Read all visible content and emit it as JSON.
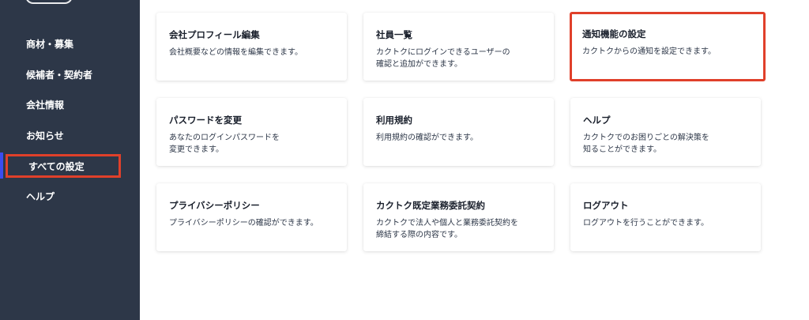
{
  "sidebar": {
    "items": [
      {
        "label": "商材・募集"
      },
      {
        "label": "候補者・契約者"
      },
      {
        "label": "会社情報"
      },
      {
        "label": "お知らせ"
      },
      {
        "label": "すべての設定"
      },
      {
        "label": "ヘルプ"
      }
    ],
    "active_index": 4
  },
  "settings": {
    "cards": [
      {
        "title": "会社プロフィール編集",
        "desc": "会社概要などの情報を編集できます。"
      },
      {
        "title": "社員一覧",
        "desc": "カクトクにログインできるユーザーの\n確認と追加ができます。"
      },
      {
        "title": "通知機能の設定",
        "desc": "カクトクからの通知を設定できます。"
      },
      {
        "title": "パスワードを変更",
        "desc": "あなたのログインパスワードを\n変更できます。"
      },
      {
        "title": "利用規約",
        "desc": "利用規約の確認ができます。"
      },
      {
        "title": "ヘルプ",
        "desc": "カクトクでのお困りごとの解決策を\n知ることができます。"
      },
      {
        "title": "プライバシーポリシー",
        "desc": "プライバシーポリシーの確認ができます。"
      },
      {
        "title": "カクトク既定業務委託契約",
        "desc": "カクトクで法人や個人と業務委託契約を\n締結する際の内容です。"
      },
      {
        "title": "ログアウト",
        "desc": "ログアウトを行うことができます。"
      }
    ]
  },
  "colors": {
    "sidebar_bg": "#2d3748",
    "active_indicator": "#3b4cf0",
    "highlight_border": "#e0402a"
  }
}
